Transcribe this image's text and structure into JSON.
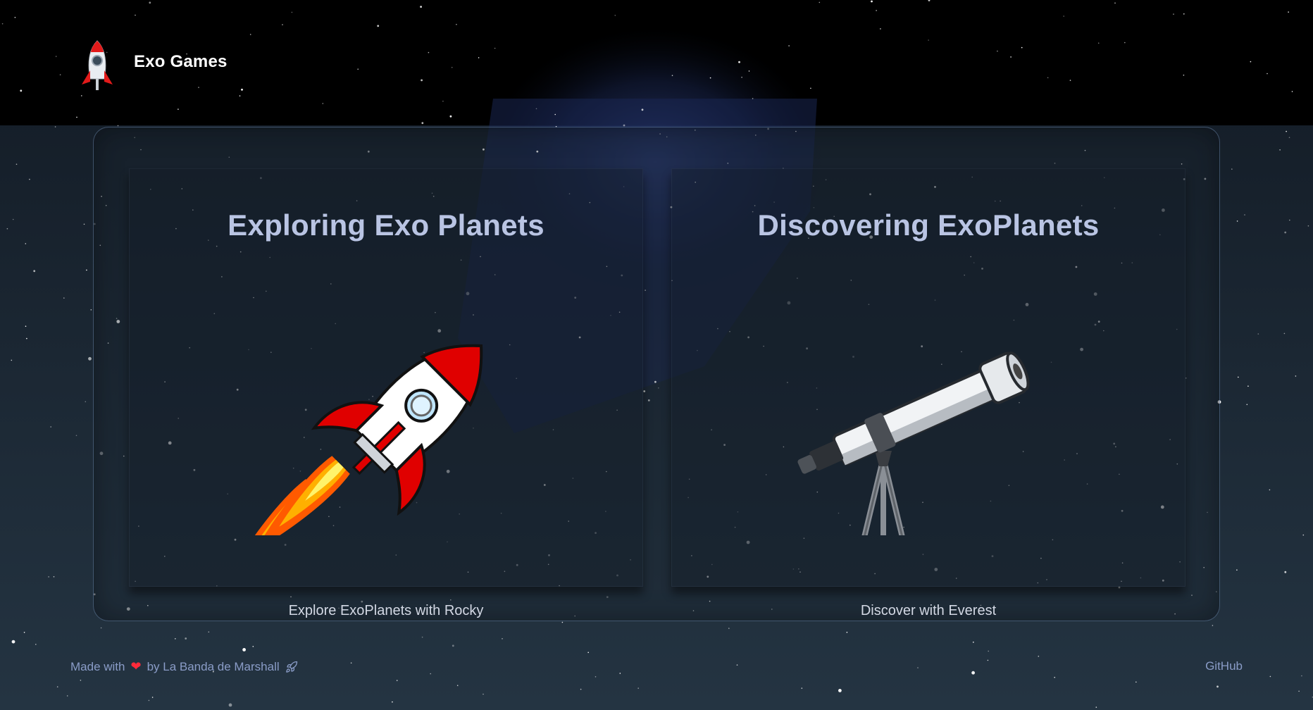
{
  "header": {
    "title": "Exo Games",
    "logo_icon": "rocket-icon"
  },
  "cards": [
    {
      "title": "Exploring Exo Planets",
      "caption": "Explore ExoPlanets with Rocky",
      "icon": "rocket-icon"
    },
    {
      "title": "Discovering ExoPlanets",
      "caption": "Discover with Everest",
      "icon": "telescope-icon"
    }
  ],
  "footer": {
    "made_with": "Made with",
    "by_text": "by La Banda de Marshall",
    "github_label": "GitHub",
    "heart_icon": "heart-icon",
    "rocket_outline_icon": "rocket-outline-icon"
  },
  "colors": {
    "background": "#0b1118",
    "header_bg": "#000000",
    "card_title": "#b9c4e3",
    "accent_red": "#e00000",
    "footer_text": "#8a9cc7"
  }
}
